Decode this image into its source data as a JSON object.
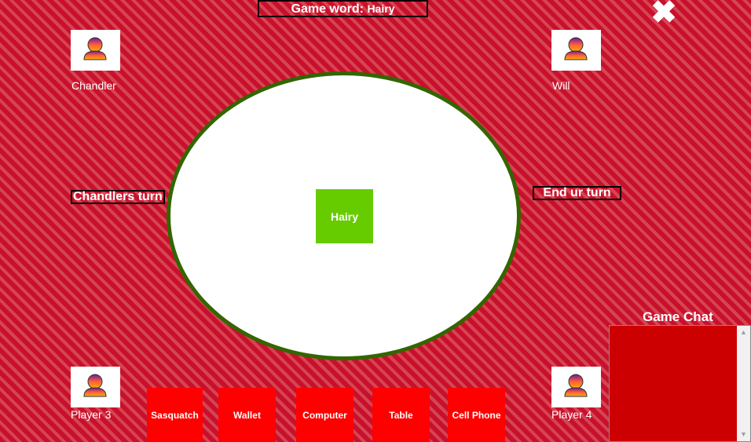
{
  "header": {
    "game_word_label": "Game word:",
    "game_word_value": "Hairy"
  },
  "close_icon": "✖",
  "players": {
    "top_left": "Chandler",
    "top_right": "Will",
    "bottom_left": "Player 3",
    "bottom_right": "Player 4"
  },
  "turn": {
    "current": "Chandlers turn",
    "end_button": "End ur turn"
  },
  "table": {
    "center_card": "Hairy"
  },
  "hand": [
    "Sasquatch",
    "Wallet",
    "Computer",
    "Table",
    "Cell Phone"
  ],
  "chat": {
    "title": "Game Chat"
  },
  "colors": {
    "background": "#c8102e",
    "table_border": "#336600",
    "center_card": "#66cc00",
    "hand_card": "#ff0000",
    "chat_box": "#cc0000"
  },
  "icons": {
    "avatar": "person-avatar-icon",
    "close": "close-icon"
  }
}
